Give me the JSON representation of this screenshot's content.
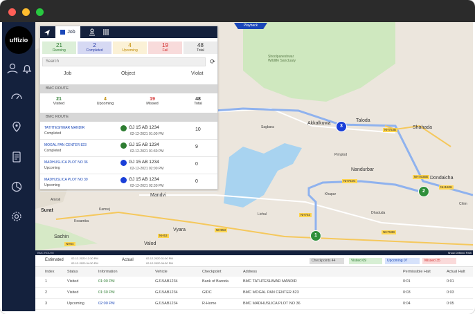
{
  "app": {
    "logo": "uffizio"
  },
  "panel": {
    "tabs": {
      "nav_icon": "navigate-icon",
      "job": "Job",
      "people_icon": "people-icon",
      "columns_icon": "columns-icon"
    },
    "stats": [
      {
        "value": "21",
        "label": "Running",
        "bg": "#dcefd8",
        "color": "#2e7d32"
      },
      {
        "value": "2",
        "label": "Completed",
        "bg": "#d6d9f3",
        "color": "#2b3fa8"
      },
      {
        "value": "4",
        "label": "Upcoming",
        "bg": "#fbf1d6",
        "color": "#c08a00"
      },
      {
        "value": "19",
        "label": "Fail",
        "bg": "#f8dbdb",
        "color": "#d32f2f"
      },
      {
        "value": "48",
        "label": "Total",
        "bg": "#ececec",
        "color": "#333333"
      }
    ],
    "search_placeholder": "Search",
    "columns": {
      "job": "Job",
      "object": "Object",
      "violation": "Violat"
    },
    "route_label": "BMC ROUTE",
    "route_stats": [
      {
        "value": "21",
        "label": "Visited",
        "color": "#2e7d32"
      },
      {
        "value": "4",
        "label": "Upcoming",
        "color": "#c08a00"
      },
      {
        "value": "19",
        "label": "Missed",
        "color": "#d32f2f"
      },
      {
        "value": "48",
        "label": "Total",
        "color": "#333333"
      }
    ],
    "route_label2": "BMC ROUTE",
    "jobs": [
      {
        "name": "TATHTESHWAR MANDIR",
        "status": "Completed",
        "vehicle": "GJ 15 AB 1234",
        "time": "02-12-2021 01:00 PM",
        "violation": "10",
        "dot": "#2e7d32"
      },
      {
        "name": "MOGAL PAN CENTER 823",
        "status": "Completed",
        "vehicle": "GJ 15 AB 1234",
        "time": "02-12-2021 01:30 PM",
        "violation": "9",
        "dot": "#2e7d32"
      },
      {
        "name": "MADHUSLICA PLOT NO 36",
        "status": "Upcoming",
        "vehicle": "GJ 15 AB 1234",
        "time": "02-12-2021 02:00 PM",
        "violation": "0",
        "dot": "#1a3fd8"
      },
      {
        "name": "MADHUSLICA PLOT NO 39",
        "status": "Upcoming",
        "vehicle": "GJ 15 AB 1234",
        "time": "02-12-2021 02:30 PM",
        "violation": "0",
        "dot": "#1a3fd8"
      }
    ]
  },
  "map": {
    "playback": "Playback",
    "towns": [
      "Taloda",
      "Shahada",
      "Akkalkuwa",
      "Nandurbar",
      "Dondaicha",
      "Surat",
      "Sachin",
      "Vyara",
      "Valod",
      "Mandvi"
    ],
    "places": [
      "Sagbara",
      "Pimplod",
      "Khapar",
      "Lichal",
      "Chim",
      "Amroli",
      "Kosamba",
      "Dhaduda",
      "Kamrej"
    ],
    "roads": [
      "NH753B",
      "NH752G",
      "NH753",
      "NH953",
      "NH53",
      "NH64",
      "NH753BB",
      "NH160H",
      "NH753B"
    ],
    "markers": [
      "1",
      "2",
      "3"
    ],
    "forest_label": "Shoolpaneshwar Wildlife Sanctuary"
  },
  "bottom": {
    "route_tag": "BMC ROUTE",
    "estimated": "Estimated",
    "est_times": [
      "02-12-2020 12:30 PM",
      "02-12-2020 04:30 PM"
    ],
    "actual": "Actual",
    "act_times": [
      "02-12-2020 01:00 PM",
      "02-12-2020 04:30 PM"
    ],
    "chips": [
      {
        "label": "Checkpoints",
        "count": "44",
        "bg": "#dddddd",
        "color": "#555555"
      },
      {
        "label": "Visited",
        "count": "09",
        "bg": "#d7efd4",
        "color": "#2e7d32"
      },
      {
        "label": "Upcoming",
        "count": "07",
        "bg": "#d6e2fb",
        "color": "#1a47b8"
      },
      {
        "label": "Missed",
        "count": "35",
        "bg": "#fadada",
        "color": "#d32f2f"
      }
    ],
    "show_path": "Show Defined Path",
    "headers": [
      "Index",
      "Status",
      "Information",
      "Vehicle",
      "Checkpoint",
      "Address",
      "Permissible Halt",
      "Actual Halt"
    ],
    "rows": [
      {
        "index": "1",
        "status": "Visited",
        "info": "01:00 PM",
        "info_color": "#2e7d32",
        "vehicle": "GJ15AB1234",
        "checkpoint": "Bank of Baroda",
        "address": "BMC TATHTESHWAR MANDIR",
        "perm": "0:01",
        "actual": "0:01"
      },
      {
        "index": "2",
        "status": "Visited",
        "info": "01:30 PM",
        "info_color": "#2e7d32",
        "vehicle": "GJ15AB1234",
        "checkpoint": "GIDC",
        "address": "BMC MOGAL PAN CENTER 823",
        "perm": "0:03",
        "actual": "0:03"
      },
      {
        "index": "3",
        "status": "Upcoming",
        "info": "02:00 PM",
        "info_color": "#1a47b8",
        "vehicle": "GJ15AB1234",
        "checkpoint": "R-Home",
        "address": "BMC MADHUSLICA PLOT NO 36",
        "perm": "0:04",
        "actual": "0:05"
      }
    ]
  }
}
